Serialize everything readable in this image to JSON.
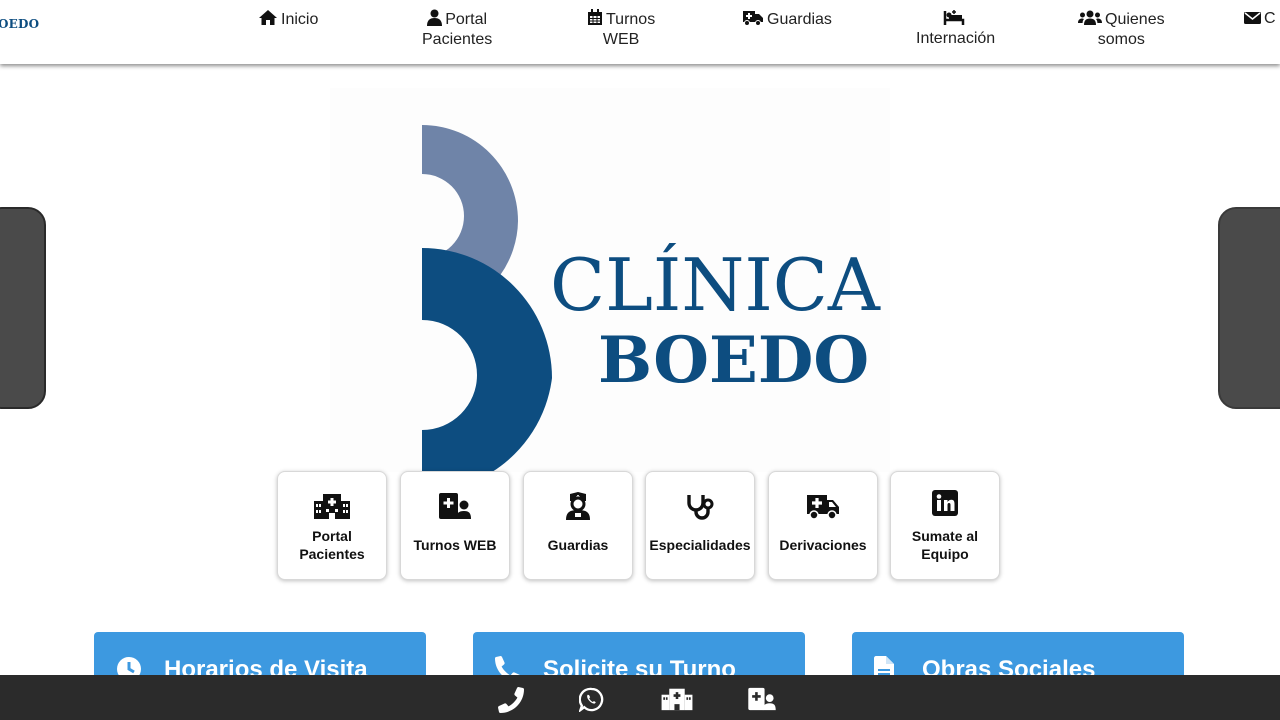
{
  "header": {
    "brand": "OEDO",
    "nav": [
      {
        "label": "Inicio",
        "label2": ""
      },
      {
        "label": "Portal",
        "label2": "Pacientes"
      },
      {
        "label": "Turnos",
        "label2": "WEB"
      },
      {
        "label": "Guardias",
        "label2": ""
      },
      {
        "label": "",
        "label2": "Internación"
      },
      {
        "label": "Quienes",
        "label2": "somos"
      },
      {
        "label": "C",
        "label2": ""
      }
    ]
  },
  "hero": {
    "logo_line1": "CLÍNICA",
    "logo_line2": "BOEDO",
    "colors": {
      "light": "#6f84a8",
      "dark": "#0d4d80"
    }
  },
  "cards": [
    {
      "line1": "Portal",
      "line2": "Pacientes",
      "icon": "hospital-icon"
    },
    {
      "line1": "Turnos WEB",
      "line2": "",
      "icon": "notes-medical-user-icon"
    },
    {
      "line1": "Guardias",
      "line2": "",
      "icon": "user-nurse-icon"
    },
    {
      "line1": "Especialidades",
      "line2": "",
      "icon": "stethoscope-icon"
    },
    {
      "line1": "Derivaciones",
      "line2": "",
      "icon": "ambulance-icon"
    },
    {
      "line1": "Sumate al",
      "line2": "Equipo",
      "icon": "linkedin-icon"
    }
  ],
  "info_boxes": [
    {
      "title": "Horarios de Visita",
      "icon": "clock-icon"
    },
    {
      "title": "Solicite su Turno",
      "icon": "phone-icon"
    },
    {
      "title": "Obras Sociales",
      "icon": "file-icon"
    }
  ],
  "bottom_bar": {
    "icons": [
      "phone-icon",
      "whatsapp-icon",
      "hospital-icon",
      "notes-medical-user-icon"
    ],
    "background": "#2b2b2b"
  },
  "accent": "#3d99e0"
}
